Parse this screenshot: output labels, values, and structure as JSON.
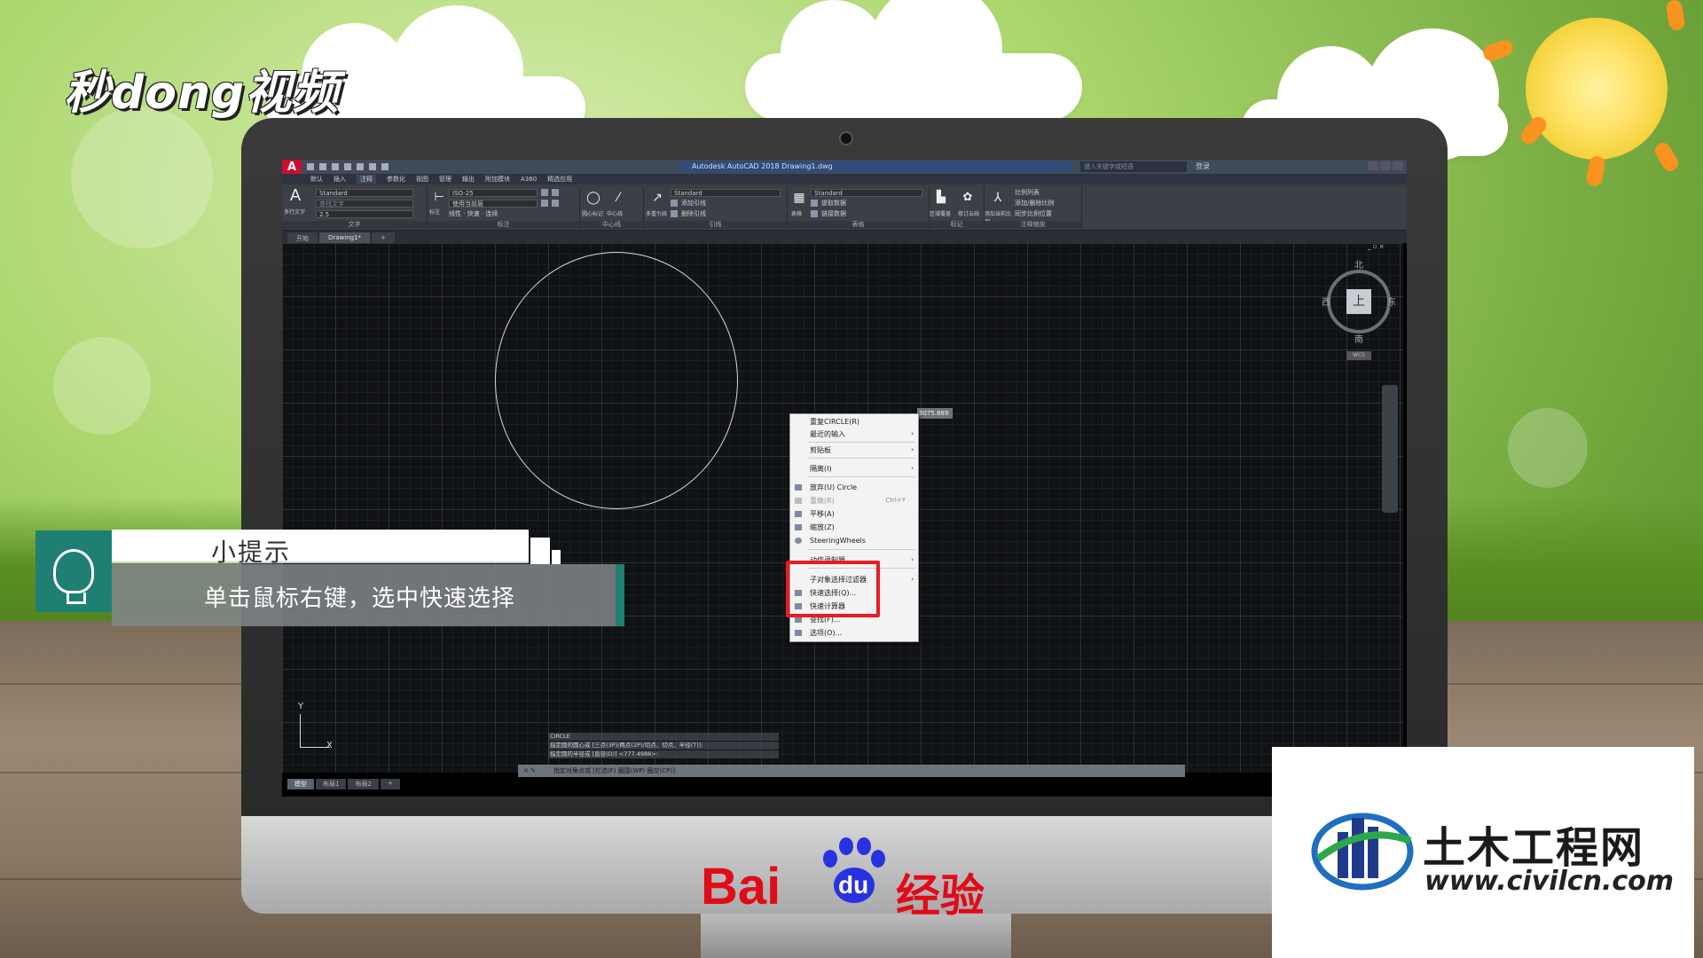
{
  "brand": {
    "logo_text": "秒dong视频"
  },
  "autocad": {
    "app_letter": "A",
    "title": "Autodesk AutoCAD 2018   Drawing1.dwg",
    "search_placeholder": "键入关键字或短语",
    "login": "登录",
    "menu": [
      "默认",
      "插入",
      "注释",
      "参数化",
      "视图",
      "管理",
      "输出",
      "附加模块",
      "A360",
      "精选应用"
    ],
    "menu_active_index": 2,
    "ribbon": {
      "text_panel": {
        "big_label": "多行文字",
        "style": "Standard",
        "find": "查找文字",
        "height": "2.5",
        "title": "文字"
      },
      "dim_panel": {
        "big_label": "标注",
        "style": "ISO-25",
        "layer": "使用当前层",
        "row3": "线性 · 快速 · 连续",
        "title": "标注"
      },
      "center_panel": {
        "labels": [
          "圆心标记",
          "中心线"
        ],
        "title": "中心线"
      },
      "leader_panel": {
        "big_label": "多重引线",
        "style": "Standard",
        "add": "添加引线",
        "remove": "删除引线",
        "title": "引线"
      },
      "table_panel": {
        "big_label": "表格",
        "style": "Standard",
        "extract": "提取数据",
        "link": "链接数据",
        "title": "表格"
      },
      "mark_panel": {
        "labels": [
          "区域覆盖",
          "修订云线"
        ],
        "title": "标记"
      },
      "scale_panel": {
        "big_label": "添加当前比例",
        "items": [
          "比例列表",
          "添加/删除比例",
          "同步比例位置"
        ],
        "title": "注释缩放"
      }
    },
    "doc_tabs": [
      "开始",
      "Drawing1*"
    ],
    "doc_tab_active": 1,
    "viewport_controls": "_ ▫ ×",
    "viewcube": {
      "top_face": "上",
      "north": "北",
      "south": "南",
      "east": "东",
      "west": "西",
      "wcs": "WCS"
    },
    "coord_tip": "3075.889",
    "ucs": {
      "x": "X",
      "y": "Y"
    },
    "context_menu": {
      "items": [
        {
          "label": "重复CIRCLE(R)"
        },
        {
          "label": "最近的输入",
          "arrow": "›"
        },
        {
          "label": "剪贴板",
          "arrow": "›"
        },
        {
          "label": "隔离(I)",
          "arrow": "›"
        },
        {
          "label": "放弃(U) Circle"
        },
        {
          "label": "重做(R)",
          "shortcut": "Ctrl+Y",
          "disabled": true
        },
        {
          "label": "平移(A)"
        },
        {
          "label": "缩放(Z)"
        },
        {
          "label": "SteeringWheels"
        },
        {
          "label": "动作录制器",
          "arrow": "›"
        },
        {
          "label": "子对象选择过滤器",
          "arrow": "›"
        },
        {
          "label": "快速选择(Q)..."
        },
        {
          "label": "快速计算器"
        },
        {
          "label": "查找(F)..."
        },
        {
          "label": "选项(O)..."
        }
      ]
    },
    "command_history": [
      "CIRCLE",
      "指定圆的圆心或 [三点(3P)/两点(2P)/切点、切点、半径(T)]:",
      "指定圆的半径或 [直径(D)] <777.4988>:"
    ],
    "command_line": "指定对角点或 [栏选(F) 圈围(WP) 圈交(CP)]:",
    "layout_tabs": [
      "模型",
      "布局1",
      "布局2",
      "+"
    ],
    "layout_active": 0,
    "status_label": "模型"
  },
  "tip": {
    "title": "小提示",
    "text": "单击鼠标右键，选中快速选择"
  },
  "watermarks": {
    "baidu": "Bai",
    "baidu_du": "du",
    "baidu_suffix": "经验",
    "civil_title": "土木工程网",
    "civil_url": "www.civilcn.com"
  },
  "colors": {
    "highlight": "#e81b23",
    "tip_accent": "#1f7f72",
    "baidu_red": "#e10b18",
    "baidu_blue": "#2932e1"
  }
}
